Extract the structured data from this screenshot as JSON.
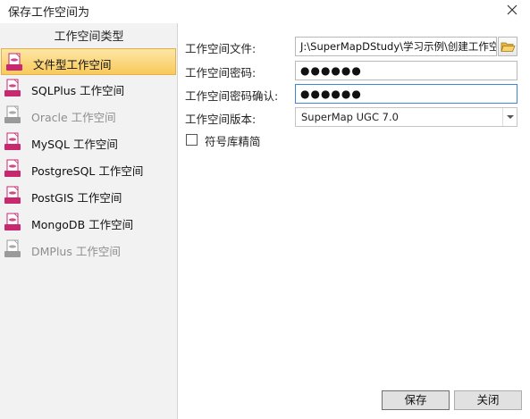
{
  "window": {
    "title": "保存工作空间为"
  },
  "left": {
    "header": "工作空间类型",
    "items": [
      {
        "label": "文件型工作空间",
        "icon": "file-workspace-icon",
        "selected": true,
        "disabled": false,
        "color": "#c8286e"
      },
      {
        "label": "SQLPlus 工作空间",
        "icon": "sqlplus-icon",
        "selected": false,
        "disabled": false,
        "color": "#c8286e"
      },
      {
        "label": "Oracle 工作空间",
        "icon": "oracle-icon",
        "selected": false,
        "disabled": true,
        "color": "#9a9a9a"
      },
      {
        "label": "MySQL 工作空间",
        "icon": "mysql-icon",
        "selected": false,
        "disabled": false,
        "color": "#c8286e"
      },
      {
        "label": "PostgreSQL 工作空间",
        "icon": "postgresql-icon",
        "selected": false,
        "disabled": false,
        "color": "#c8286e"
      },
      {
        "label": "PostGIS 工作空间",
        "icon": "postgis-icon",
        "selected": false,
        "disabled": false,
        "color": "#c8286e"
      },
      {
        "label": "MongoDB 工作空间",
        "icon": "mongodb-icon",
        "selected": false,
        "disabled": false,
        "color": "#c8286e"
      },
      {
        "label": "DMPlus 工作空间",
        "icon": "dmplus-icon",
        "selected": false,
        "disabled": true,
        "color": "#9a9a9a"
      }
    ]
  },
  "form": {
    "file_label": "工作空间文件:",
    "file_value": "J:\\SuperMapDStudy\\学习示例\\创建工作空",
    "password_label": "工作空间密码:",
    "password_value": "●●●●●●",
    "confirm_label": "工作空间密码确认:",
    "confirm_value": "●●●●●●",
    "version_label": "工作空间版本:",
    "version_value": "SuperMap UGC 7.0",
    "symbol_label": "符号库精简"
  },
  "buttons": {
    "save": "保存",
    "close": "关闭"
  },
  "colors": {
    "selected_bg": "#f8c95b",
    "focus_border": "#3f86d9",
    "icon_accent": "#c8286e"
  }
}
